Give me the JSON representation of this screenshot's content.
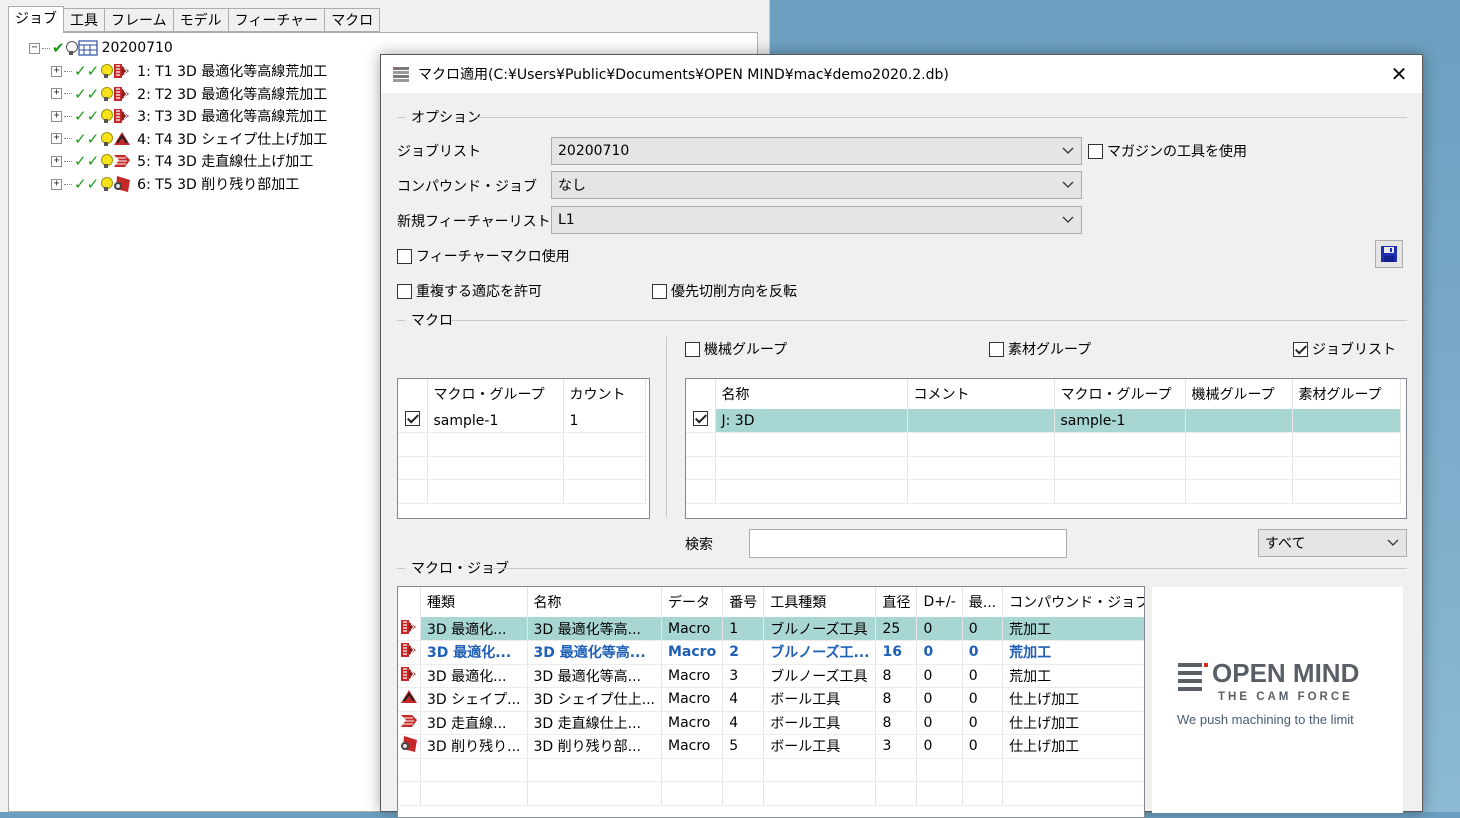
{
  "left_panel": {
    "tabs": [
      "ジョブ",
      "工具",
      "フレーム",
      "モデル",
      "フィーチャー",
      "マクロ"
    ],
    "root": {
      "label": "20200710"
    },
    "jobs": [
      {
        "label": "1: T1 3D 最適化等高線荒加工",
        "icon": "roughing-icon"
      },
      {
        "label": "2: T2 3D 最適化等高線荒加工",
        "icon": "roughing-icon"
      },
      {
        "label": "3: T3 3D 最適化等高線荒加工",
        "icon": "roughing-icon"
      },
      {
        "label": "4: T4 3D シェイプ仕上げ加工",
        "icon": "shape-finishing-icon"
      },
      {
        "label": "5: T4 3D 走直線仕上げ加工",
        "icon": "linear-finishing-icon"
      },
      {
        "label": "6: T5 3D 削り残り部加工",
        "icon": "rest-machining-icon"
      }
    ]
  },
  "dialog": {
    "title": "マクロ適用(C:¥Users¥Public¥Documents¥OPEN MIND¥mac¥demo2020.2.db)",
    "close": "✕",
    "options": {
      "group_label": "オプション",
      "joblist_label": "ジョブリスト",
      "joblist_value": "20200710",
      "compound_label": "コンパウンド・ジョブ",
      "compound_value": "なし",
      "feature_list_label": "新規フィーチャーリスト",
      "feature_list_value": "L1",
      "magazine_tools": {
        "label": "マガジンの工具を使用",
        "checked": false
      },
      "feature_macro": {
        "label": "フィーチャーマクロ使用",
        "checked": false
      },
      "allow_duplicate": {
        "label": "重複する適応を許可",
        "checked": false
      },
      "reverse_direction": {
        "label": "優先切削方向を反転",
        "checked": false
      }
    },
    "macro": {
      "group_label": "マクロ",
      "machine_group": {
        "label": "機械グループ",
        "checked": false
      },
      "material_group": {
        "label": "素材グループ",
        "checked": false
      },
      "joblist_filter": {
        "label": "ジョブリスト",
        "checked": true
      },
      "groups_table": {
        "columns": [
          "",
          "マクロ・グループ",
          "カウント"
        ],
        "rows": [
          {
            "checked": true,
            "group": "sample-1",
            "count": "1"
          }
        ]
      },
      "macros_table": {
        "columns": [
          "",
          "名称",
          "コメント",
          "マクロ・グループ",
          "機械グループ",
          "素材グループ"
        ],
        "rows": [
          {
            "checked": true,
            "name": "J: 3D",
            "comment": "",
            "group": "sample-1",
            "machine": "",
            "material": "",
            "selected": true
          }
        ]
      },
      "search_label": "検索",
      "search_value": "",
      "filter_value": "すべて"
    },
    "macro_jobs": {
      "group_label": "マクロ・ジョブ",
      "columns": [
        "",
        "種類",
        "名称",
        "データ",
        "番号",
        "工具種類",
        "直径",
        "D+/-",
        "最...",
        "コンパウンド・ジョブ"
      ],
      "rows": [
        {
          "icon": "roughing-icon",
          "type": "3D 最適化...",
          "name": "3D 最適化等高...",
          "data": "Macro",
          "no": "1",
          "tool": "ブルノーズ工具",
          "dia": "25",
          "dpm": "0",
          "max": "0",
          "compound": "荒加工",
          "state": "selected"
        },
        {
          "icon": "roughing-icon",
          "type": "3D 最適化...",
          "name": "3D 最適化等高...",
          "data": "Macro",
          "no": "2",
          "tool": "ブルノーズ工...",
          "dia": "16",
          "dpm": "0",
          "max": "0",
          "compound": "荒加工",
          "state": "bold"
        },
        {
          "icon": "roughing-icon",
          "type": "3D 最適化...",
          "name": "3D 最適化等高...",
          "data": "Macro",
          "no": "3",
          "tool": "ブルノーズ工具",
          "dia": "8",
          "dpm": "0",
          "max": "0",
          "compound": "荒加工",
          "state": ""
        },
        {
          "icon": "shape-finishing-icon",
          "type": "3D シェイプ...",
          "name": "3D シェイプ仕上...",
          "data": "Macro",
          "no": "4",
          "tool": "ボール工具",
          "dia": "8",
          "dpm": "0",
          "max": "0",
          "compound": "仕上げ加工",
          "state": ""
        },
        {
          "icon": "linear-finishing-icon",
          "type": "3D 走直線...",
          "name": "3D 走直線仕上...",
          "data": "Macro",
          "no": "4",
          "tool": "ボール工具",
          "dia": "8",
          "dpm": "0",
          "max": "0",
          "compound": "仕上げ加工",
          "state": ""
        },
        {
          "icon": "rest-machining-icon",
          "type": "3D 削り残り...",
          "name": "3D 削り残り部...",
          "data": "Macro",
          "no": "5",
          "tool": "ボール工具",
          "dia": "3",
          "dpm": "0",
          "max": "0",
          "compound": "仕上げ加工",
          "state": ""
        }
      ]
    },
    "logo": {
      "brand": "OPEN MIND",
      "tagline": "THE CAM FORCE",
      "slogan": "We push machining to the limit"
    }
  }
}
